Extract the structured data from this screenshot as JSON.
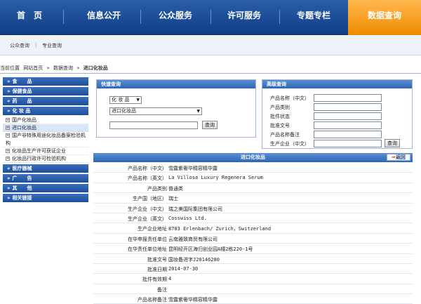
{
  "topnav": {
    "items": [
      {
        "label": "首　页"
      },
      {
        "label": "信息公开"
      },
      {
        "label": "公众服务"
      },
      {
        "label": "许可服务"
      },
      {
        "label": "专题专栏"
      },
      {
        "label": "数据查询"
      }
    ],
    "active_color": "#f39400",
    "bar_color": "#1a4b95"
  },
  "subnav": {
    "items": [
      "公众查询",
      "专业查询"
    ]
  },
  "breadcrumb": [
    "当前位置",
    "网站首页",
    "»",
    "数据查询",
    "»",
    "进口化妆品"
  ],
  "sidebar": {
    "cats": [
      {
        "label": "食　　品"
      },
      {
        "label": "保健食品"
      },
      {
        "label": "药　　品"
      },
      {
        "label": "化 妆 品"
      }
    ],
    "subs": [
      {
        "label": "国产化妆品"
      },
      {
        "label": "进口化妆品"
      },
      {
        "label": "国产非特殊用途化妆品备案检验机构"
      },
      {
        "label": "化妆品生产许可获证企业"
      },
      {
        "label": "化妆品行政许可检验机构"
      }
    ],
    "cats2": [
      {
        "label": "医疗器械"
      },
      {
        "label": "广　　告"
      },
      {
        "label": "其　　他"
      },
      {
        "label": "相关链接"
      }
    ]
  },
  "quick": {
    "title": "快速查询",
    "select1": "化 妆 品",
    "select2": "进口化妆品",
    "input": "",
    "button": "查询"
  },
  "advanced": {
    "title": "高级查询",
    "fields": [
      "产品名称（中文）",
      "产品类别",
      "批件状态",
      "批准文号",
      "产品名称备注",
      "生产企业（中文）"
    ],
    "button": "查询"
  },
  "result": {
    "title": "进口化妆品",
    "back": "返回",
    "rows": [
      {
        "label": "产品名称（中文）",
        "value": "雪露紫奢华精容精华露"
      },
      {
        "label": "产品名称（英文）",
        "value": "La Villosa Luxury Regenera Serum"
      },
      {
        "label": "产品类别",
        "value": "普通类"
      },
      {
        "label": "生产国（地区）",
        "value": "瑞士"
      },
      {
        "label": "生产企业（中文）",
        "value": "瑞之美国际集团有限公司"
      },
      {
        "label": "生产企业（英文）",
        "value": "Cosswiss Ltd."
      },
      {
        "label": "生产企业地址",
        "value": "8703 Erlenbach/ Zurich，Switzerland"
      },
      {
        "label": "在华申报责任单位",
        "value": "云南雅致商贸有限公司"
      },
      {
        "label": "在华责任单位地址",
        "value": "昆明经开区海归创业园A幢2栋220-1号"
      },
      {
        "label": "批准文号",
        "value": "国妆备进字J20146280"
      },
      {
        "label": "批准日期",
        "value": "2014-07-30"
      },
      {
        "label": "批件有效期",
        "value": "4"
      },
      {
        "label": "备注",
        "value": ""
      },
      {
        "label": "产品名称备注",
        "value": "雪露紫奢华精容精华露"
      }
    ]
  }
}
